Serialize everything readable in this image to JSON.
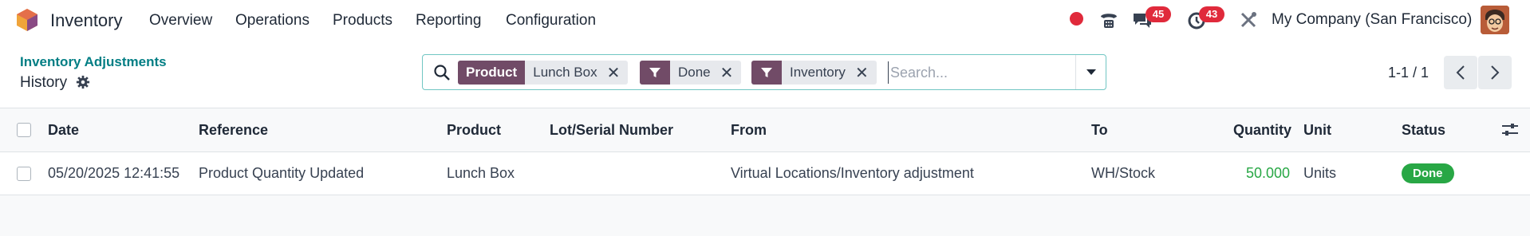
{
  "navbar": {
    "app_name": "Inventory",
    "menu": [
      "Overview",
      "Operations",
      "Products",
      "Reporting",
      "Configuration"
    ],
    "chat_count": "45",
    "activity_count": "43",
    "company": "My Company (San Francisco)"
  },
  "control_panel": {
    "breadcrumb": "Inventory Adjustments",
    "title": "History",
    "search": {
      "placeholder": "Search...",
      "facets": [
        {
          "tag": "Product",
          "value": "Lunch Box"
        },
        {
          "tag": "filter-icon",
          "value": "Done"
        },
        {
          "tag": "filter-icon",
          "value": "Inventory"
        }
      ]
    },
    "pager": "1-1 / 1"
  },
  "table": {
    "columns": [
      "Date",
      "Reference",
      "Product",
      "Lot/Serial Number",
      "From",
      "To",
      "Quantity",
      "Unit",
      "Status"
    ],
    "rows": [
      {
        "date": "05/20/2025 12:41:55",
        "reference": "Product Quantity Updated",
        "product": "Lunch Box",
        "lot": "",
        "from": "Virtual Locations/Inventory adjustment",
        "to": "WH/Stock",
        "quantity": "50.000",
        "unit": "Units",
        "status": "Done"
      }
    ]
  },
  "colors": {
    "brand": "#714b67",
    "teal": "#017e84",
    "success": "#28a745",
    "badge": "#e02a3b"
  }
}
